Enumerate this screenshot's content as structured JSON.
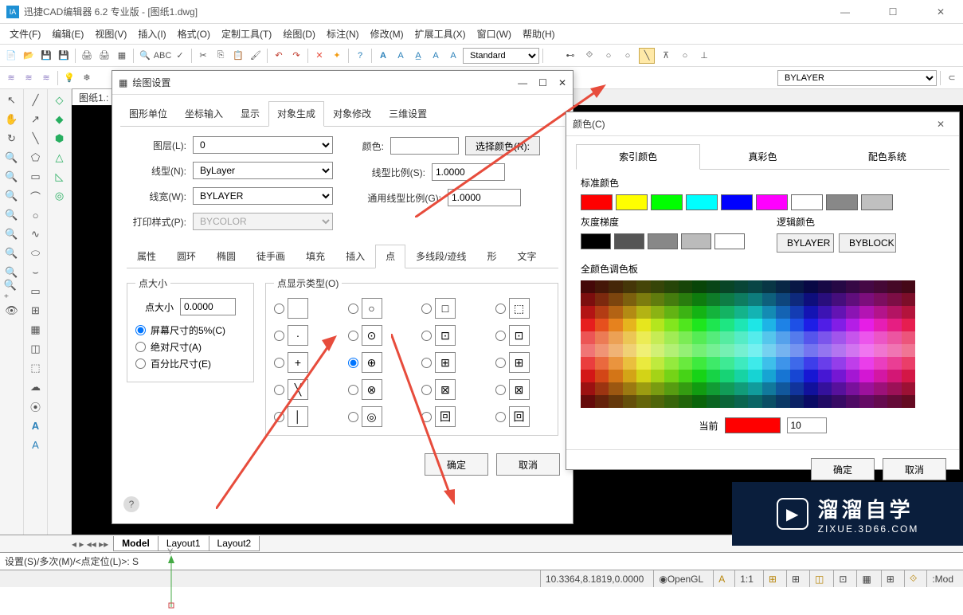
{
  "title": "迅捷CAD编辑器 6.2 专业版 - [图纸1.dwg]",
  "menu": [
    "文件(F)",
    "编辑(E)",
    "视图(V)",
    "插入(I)",
    "格式(O)",
    "定制工具(T)",
    "绘图(D)",
    "标注(N)",
    "修改(M)",
    "扩展工具(X)",
    "窗口(W)",
    "帮助(H)"
  ],
  "text_style": "Standard",
  "bylayer_combo": "BYLAYER",
  "sheet_tab": "图纸1.:",
  "bottom_tabs": [
    "Model",
    "Layout1",
    "Layout2"
  ],
  "cmdline": "设置(S)/多次(M)/<点定位(L)>: S",
  "status": {
    "coord": "10.3364,8.1819,0.0000",
    "render": "OpenGL",
    "mode": "1:1",
    "end": ":Mod"
  },
  "dlg": {
    "title": "绘图设置",
    "tabs": [
      "图形单位",
      "坐标输入",
      "显示",
      "对象生成",
      "对象修改",
      "三维设置"
    ],
    "layer_label": "图层(L):",
    "layer_val": "0",
    "linetype_label": "线型(N):",
    "linetype_val": "ByLayer",
    "lineweight_label": "线宽(W):",
    "lineweight_val": "BYLAYER",
    "plotstyle_label": "打印样式(P):",
    "plotstyle_val": "BYCOLOR",
    "color_label": "颜色:",
    "choose_color": "选择颜色(R):",
    "ltscale_label": "线型比例(S):",
    "ltscale_val": "1.0000",
    "globalscale_label": "通用线型比例(G):",
    "globalscale_val": "1.0000",
    "subtabs": [
      "属性",
      "圆环",
      "椭圆",
      "徒手画",
      "填充",
      "插入",
      "点",
      "多线段/迹线",
      "形",
      "文字"
    ],
    "pt_size_legend": "点大小",
    "pt_size_label": "点大小",
    "pt_size_val": "0.0000",
    "pt_opt1": "屏幕尺寸的5%(C)",
    "pt_opt2": "绝对尺寸(A)",
    "pt_opt3": "百分比尺寸(E)",
    "pt_disp_legend": "点显示类型(O)",
    "ok": "确定",
    "cancel": "取消"
  },
  "color_dlg": {
    "title": "颜色(C)",
    "tabs": [
      "索引颜色",
      "真彩色",
      "配色系统"
    ],
    "std_label": "标准颜色",
    "std": [
      "#ff0000",
      "#ffff00",
      "#00ff00",
      "#00ffff",
      "#0000ff",
      "#ff00ff",
      "#ffffff",
      "#888888",
      "#c0c0c0"
    ],
    "gray_label": "灰度梯度",
    "gray": [
      "#000000",
      "#555555",
      "#888888",
      "#bbbbbb",
      "#ffffff"
    ],
    "logic_label": "逻辑颜色",
    "bylayer": "BYLAYER",
    "byblock": "BYBLOCK",
    "palette_label": "全颜色调色板",
    "current_label": "当前",
    "current_val": "10",
    "ok": "确定",
    "cancel": "取消"
  },
  "watermark": {
    "brand": "溜溜自学",
    "url": "ZIXUE.3D66.COM"
  }
}
